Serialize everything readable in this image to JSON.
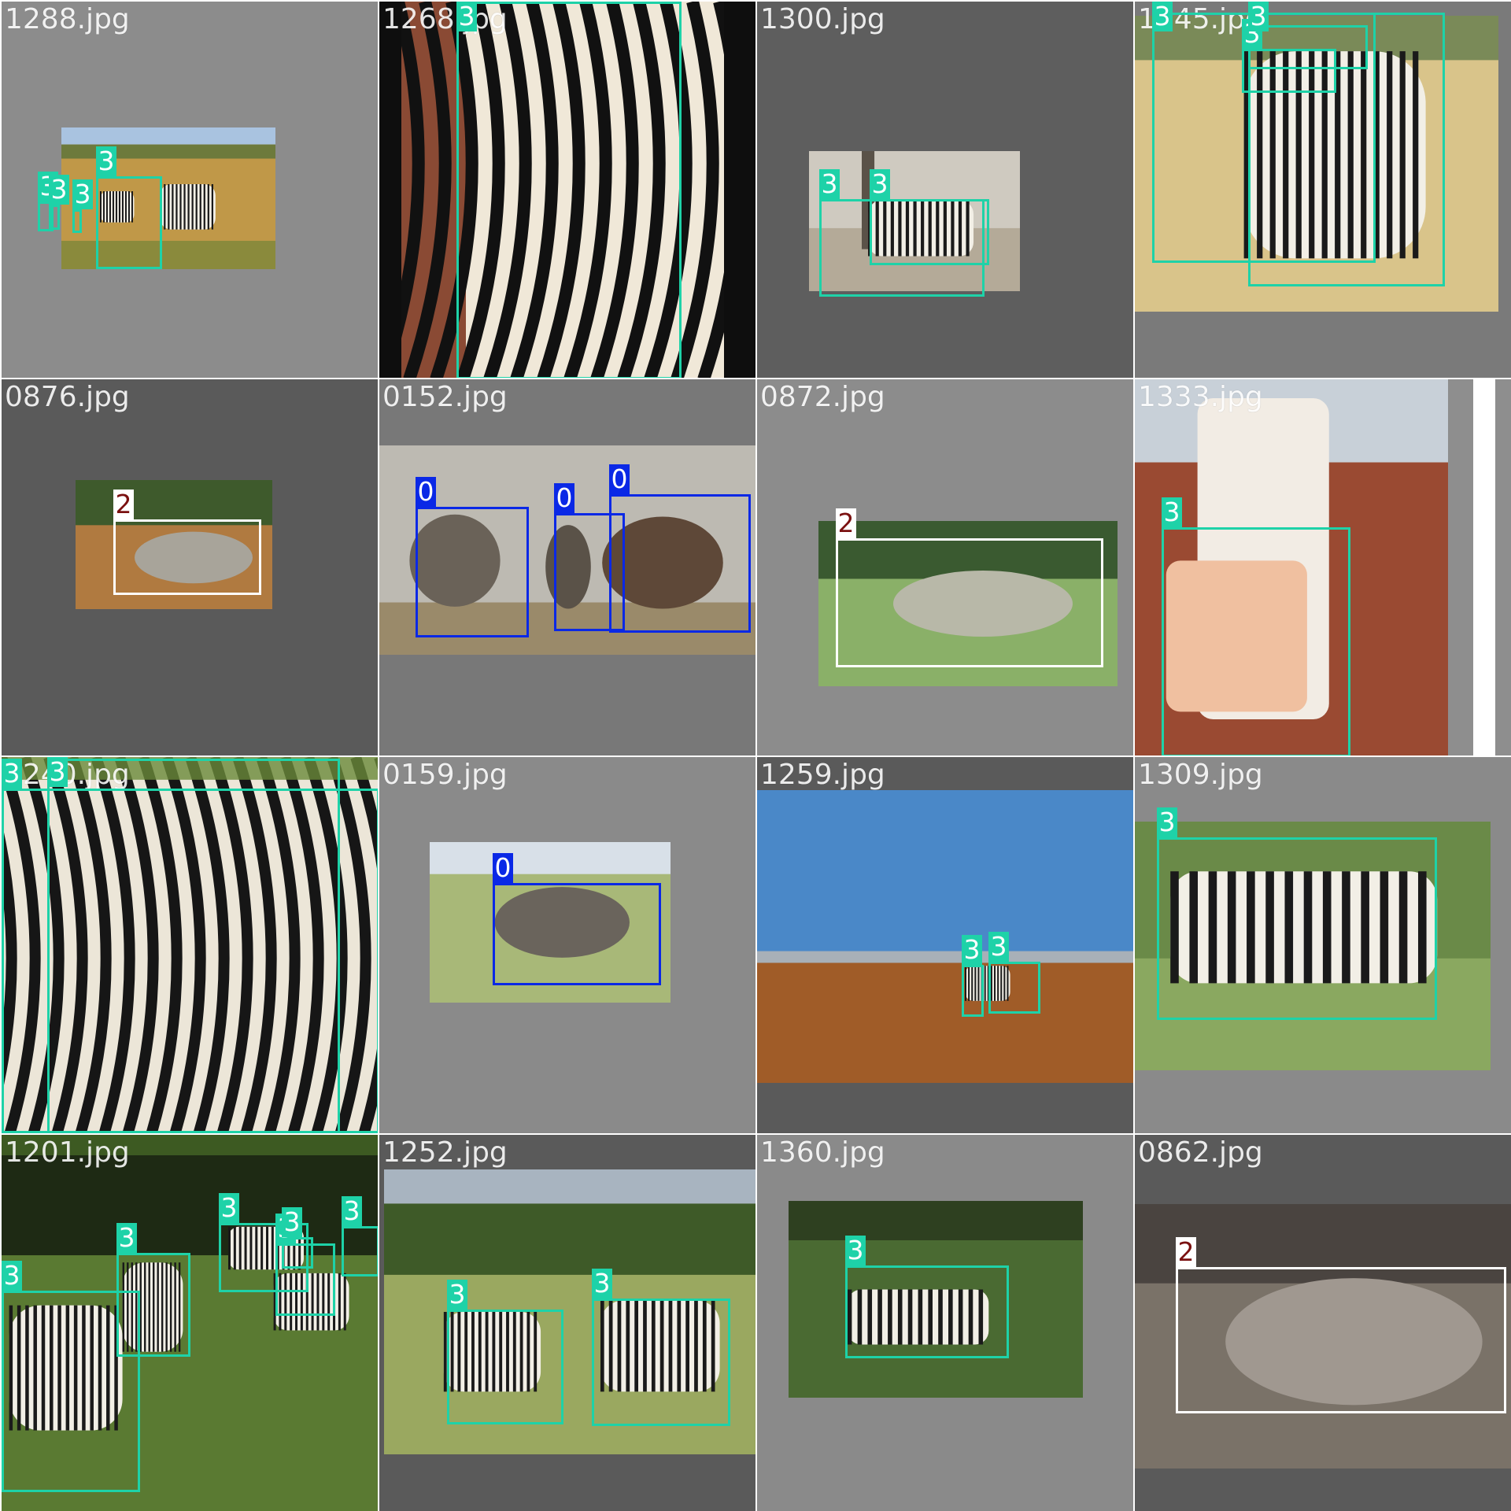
{
  "classes": {
    "0": {
      "name": "0",
      "color": "#0a28e6",
      "text": "#ffffff"
    },
    "2": {
      "name": "2",
      "color": "#ffffff",
      "text": "#7a1010"
    },
    "3": {
      "name": "3",
      "color": "#1ed2a8",
      "text": "#ffffff"
    }
  },
  "tiles": [
    {
      "filename": "1288.jpg",
      "bg": "#8c8c8c",
      "scene": "savanna",
      "boxes": [
        {
          "cls": "3"
        },
        {
          "cls": "3"
        },
        {
          "cls": "3"
        },
        {
          "cls": "3"
        }
      ]
    },
    {
      "filename": "1268.jpg",
      "bg": "#0e0e0e",
      "scene": "zebra-closeup",
      "boxes": [
        {
          "cls": "3"
        }
      ]
    },
    {
      "filename": "1300.jpg",
      "bg": "#5e5e5e",
      "scene": "pale-grass",
      "boxes": [
        {
          "cls": "3"
        },
        {
          "cls": "3"
        }
      ]
    },
    {
      "filename": "1345.jpg",
      "bg": "#7a7a7a",
      "scene": "dry-grass",
      "boxes": [
        {
          "cls": "3"
        },
        {
          "cls": "3"
        },
        {
          "cls": "3"
        },
        {
          "cls": "3"
        }
      ]
    },
    {
      "filename": "0876.jpg",
      "bg": "#5a5a5a",
      "scene": "dusty",
      "boxes": [
        {
          "cls": "2"
        }
      ]
    },
    {
      "filename": "0152.jpg",
      "bg": "#787878",
      "scene": "misty",
      "boxes": [
        {
          "cls": "0"
        },
        {
          "cls": "0"
        },
        {
          "cls": "0"
        }
      ]
    },
    {
      "filename": "0872.jpg",
      "bg": "#8c8c8c",
      "scene": "green-lawn",
      "boxes": [
        {
          "cls": "2"
        }
      ]
    },
    {
      "filename": "1333.jpg",
      "bg": "#8e8e8e",
      "scene": "red-earth",
      "boxes": [
        {
          "cls": "3"
        }
      ]
    },
    {
      "filename": "1240.jpg",
      "bg": "#5d7a2a",
      "scene": "zebra-herd-close",
      "boxes": [
        {
          "cls": "3"
        },
        {
          "cls": "3"
        }
      ]
    },
    {
      "filename": "0159.jpg",
      "bg": "#8a8a8a",
      "scene": "green-savanna",
      "boxes": [
        {
          "cls": "0"
        }
      ]
    },
    {
      "filename": "1259.jpg",
      "bg": "#5a5a5a",
      "scene": "blue-sky-plain",
      "boxes": [
        {
          "cls": "3"
        },
        {
          "cls": "3"
        }
      ]
    },
    {
      "filename": "1309.jpg",
      "bg": "#8a8a8a",
      "scene": "meadow",
      "boxes": [
        {
          "cls": "3"
        }
      ]
    },
    {
      "filename": "1201.jpg",
      "bg": "#3d5a22",
      "scene": "forest-edge",
      "boxes": [
        {
          "cls": "3"
        },
        {
          "cls": "3"
        },
        {
          "cls": "3"
        },
        {
          "cls": "3"
        },
        {
          "cls": "3"
        },
        {
          "cls": "3"
        }
      ]
    },
    {
      "filename": "1252.jpg",
      "bg": "#5a5a5a",
      "scene": "grassland",
      "boxes": [
        {
          "cls": "3"
        },
        {
          "cls": "3"
        }
      ]
    },
    {
      "filename": "1360.jpg",
      "bg": "#8a8a8a",
      "scene": "bush",
      "boxes": [
        {
          "cls": "3"
        }
      ]
    },
    {
      "filename": "0862.jpg",
      "bg": "#5a5a5a",
      "scene": "dry-brush",
      "boxes": [
        {
          "cls": "2"
        }
      ]
    }
  ]
}
